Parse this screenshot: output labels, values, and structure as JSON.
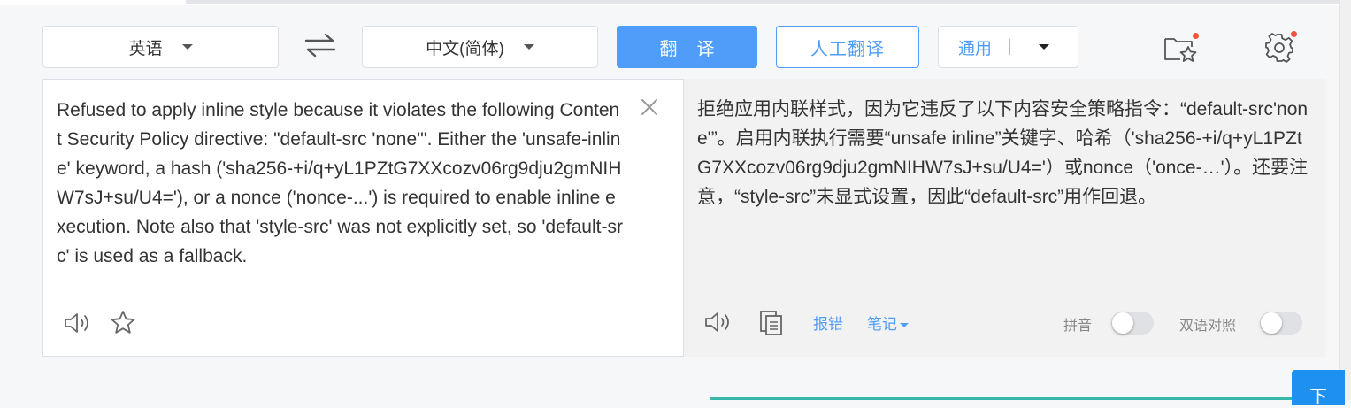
{
  "toolbar": {
    "source_lang": "英语",
    "target_lang": "中文(简体)",
    "translate_label": "翻译",
    "human_translate_label": "人工翻译",
    "domain_label": "通用"
  },
  "source": {
    "text": "Refused to apply inline style because it violates the following Content Security Policy directive: \"default-src 'none'\". Either the 'unsafe-inline' keyword, a hash ('sha256-+i/q+yL1PZtG7XXcozv06rg9dju2gmNIHW7sJ+su/U4='), or a nonce ('nonce-...') is required to enable inline execution. Note also that 'style-src' was not explicitly set, so 'default-src' is used as a fallback."
  },
  "target": {
    "text": "拒绝应用内联样式，因为它违反了以下内容安全策略指令：“default-src'none'”。启用内联执行需要“unsafe inline”关键字、哈希（'sha256-+i/q+yL1PZtG7XXcozv06rg9dju2gmNIHW7sJ+su/U4='）或nonce（'once-…'）。还要注意，“style-src”未显式设置，因此“default-src”用作回退。",
    "report_error_label": "报错",
    "notes_label": "笔记",
    "pinyin_label": "拼音",
    "bilingual_label": "双语对照",
    "pinyin_enabled": false,
    "bilingual_enabled": false
  },
  "next_button_label": "下",
  "icons": {
    "swap": "swap-arrows-icon",
    "favorites": "folder-star-icon",
    "settings": "gear-icon",
    "speaker": "speaker-icon",
    "star": "star-icon",
    "copy": "copy-icon",
    "close": "close-icon"
  },
  "colors": {
    "accent": "#4f9cf9",
    "notification_dot": "#f4533b",
    "target_panel_bg": "#f2f2f2"
  }
}
